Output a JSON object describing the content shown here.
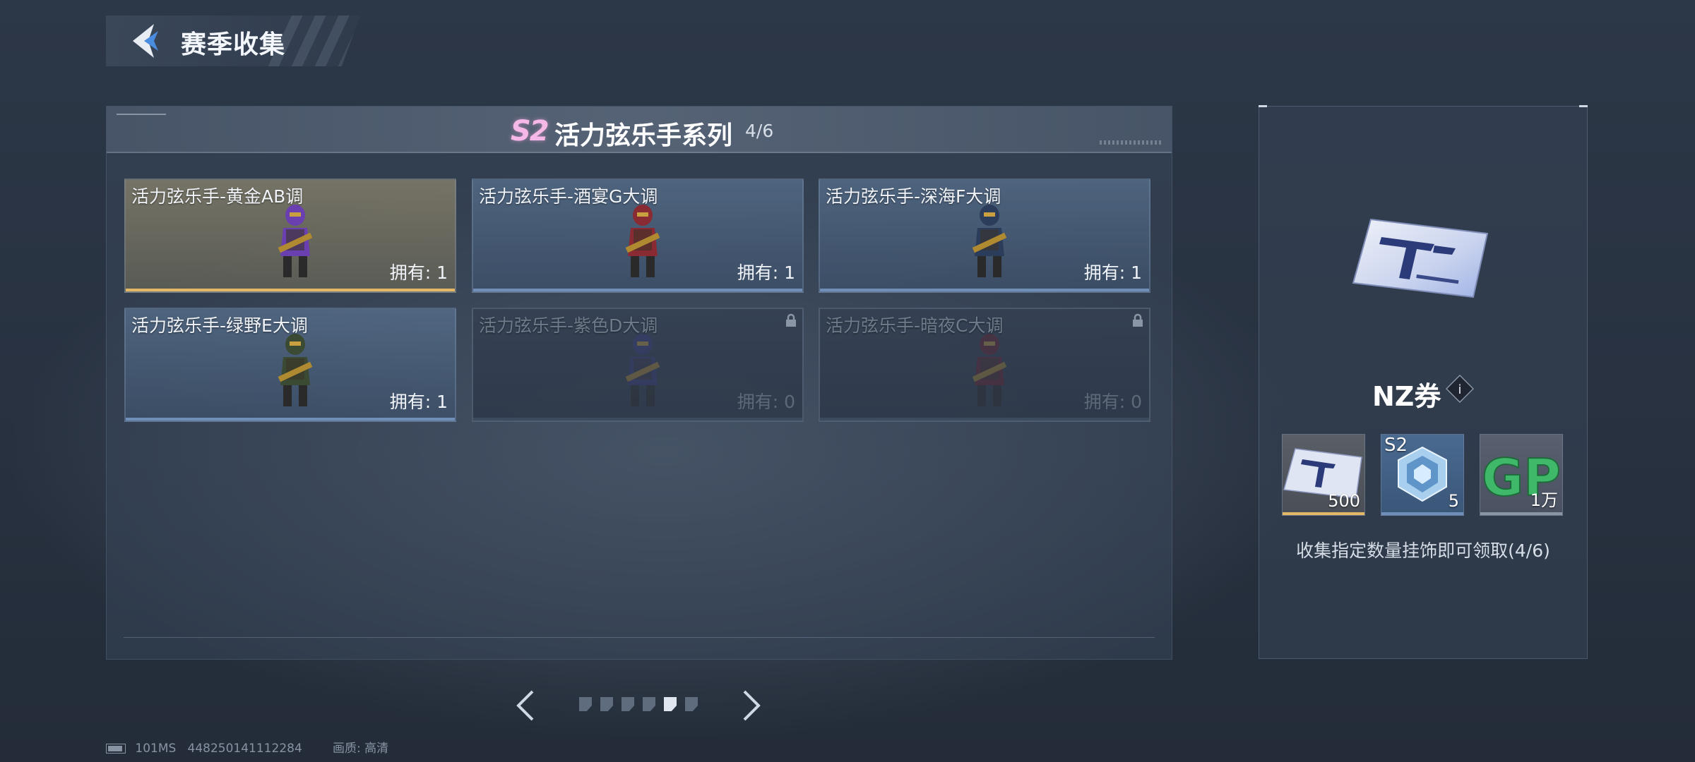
{
  "header": {
    "title": "赛季收集"
  },
  "series": {
    "badge": "S2",
    "title": "活力弦乐手系列",
    "count": "4/6"
  },
  "cards": [
    {
      "name": "活力弦乐手-黄金AB调",
      "owned": "拥有: 1",
      "style": "gold",
      "figure_color": "#6a3fb0",
      "locked": false
    },
    {
      "name": "活力弦乐手-酒宴G大调",
      "owned": "拥有: 1",
      "style": "blue",
      "figure_color": "#8a2a32",
      "locked": false
    },
    {
      "name": "活力弦乐手-深海F大调",
      "owned": "拥有: 1",
      "style": "blue",
      "figure_color": "#2c3d5c",
      "locked": false
    },
    {
      "name": "活力弦乐手-绿野E大调",
      "owned": "拥有: 1",
      "style": "blue",
      "figure_color": "#3b4a32",
      "locked": false
    },
    {
      "name": "活力弦乐手-紫色D大调",
      "owned": "拥有: 0",
      "style": "locked",
      "figure_color": "#3a3a80",
      "locked": true
    },
    {
      "name": "活力弦乐手-暗夜C大调",
      "owned": "拥有: 0",
      "style": "locked",
      "figure_color": "#6a2030",
      "locked": true
    }
  ],
  "pager": {
    "total": 6,
    "active_index": 4
  },
  "status": {
    "ping": "101MS",
    "uid": "448250141112284",
    "quality_label": "画质:",
    "quality_value": "高清"
  },
  "reward": {
    "name": "NZ券",
    "items": [
      {
        "kind": "ticket",
        "qty": "500",
        "bar_color": "#e2b866"
      },
      {
        "kind": "crystal",
        "label": "S2",
        "qty": "5",
        "bar_color": "#6f8fb8"
      },
      {
        "kind": "gp",
        "qty": "1万",
        "bar_color": "#8a95a5"
      }
    ],
    "desc": "收集指定数量挂饰即可领取(4/6)"
  },
  "colors": {
    "gold": "#e2b866",
    "blue": "#6f8fb8",
    "gp_green": "#3fb86a",
    "season_pink": "#f6b8e6"
  }
}
